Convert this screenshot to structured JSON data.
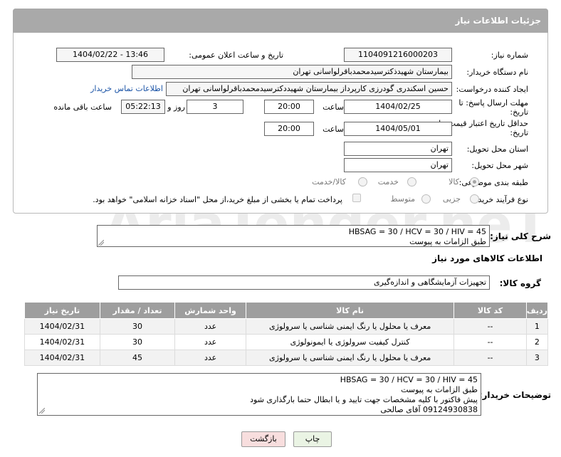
{
  "header": {
    "title": "جزئیات اطلاعات نیاز"
  },
  "fields": {
    "need_number_label": "شماره نیاز:",
    "need_number": "1104091216000203",
    "announce_label": "تاریخ و ساعت اعلان عمومی:",
    "announce_value": "1404/02/22 - 13:46",
    "buyer_org_label": "نام دستگاه خریدار:",
    "buyer_org": "بیمارستان شهیدذکترسیدمحمدباقرلواسانی تهران",
    "requester_label": "ایجاد کننده درخواست:",
    "requester": "حسین اسکندری گودرزی کارپرداز بیمارستان شهیددکترسیدمحمدباقرلواسانی تهران",
    "contact_link": "اطلاعات تماس خریدار",
    "deadline_label": "مهلت ارسال پاسخ: تا تاریخ:",
    "deadline_date": "1404/02/25",
    "time_label": "ساعت",
    "deadline_time": "20:00",
    "days_value": "3",
    "days_label": "روز و",
    "remaining_time": "05:22:13",
    "remaining_label": "ساعت باقی مانده",
    "price_validity_label": "حداقل تاریخ اعتبار قیمت: تا تاریخ:",
    "price_validity_date": "1404/05/01",
    "price_validity_time": "20:00",
    "province_label": "استان محل تحویل:",
    "province": "تهران",
    "city_label": "شهر محل تحویل:",
    "city": "تهران",
    "category_label": "طبقه بندی موضوعی:",
    "category_options": [
      "کالا",
      "خدمت",
      "کالا/خدمت"
    ],
    "category_selected": "کالا",
    "process_label": "نوع فرآیند خرید :",
    "process_options": [
      "جزیی",
      "متوسط"
    ],
    "payment_note": "پرداخت تمام یا بخشی از مبلغ خرید،از محل \"اسناد خزانه اسلامی\" خواهد بود."
  },
  "summary": {
    "label": "شرح کلی نیاز:",
    "text": "HBSAG = 30 / HCV = 30 / HIV = 45\nطبق الزامات به پیوست"
  },
  "goods": {
    "title": "اطلاعات کالاهای مورد نیاز",
    "group_label": "گروه کالا:",
    "group_value": "تجهیزات آزمایشگاهی و اندازه‌گیری"
  },
  "table": {
    "headers": [
      "ردیف",
      "کد کالا",
      "نام کالا",
      "واحد شمارش",
      "تعداد / مقدار",
      "تاریخ نیاز"
    ],
    "rows": [
      [
        "1",
        "--",
        "معرف یا محلول یا رنگ ایمنی شناسی یا سرولوژی",
        "عدد",
        "30",
        "1404/02/31"
      ],
      [
        "2",
        "--",
        "کنترل کیفیت سرولوژی یا ایمونولوژی",
        "عدد",
        "30",
        "1404/02/31"
      ],
      [
        "3",
        "--",
        "معرف یا محلول یا رنگ ایمنی شناسی یا سرولوژی",
        "عدد",
        "45",
        "1404/02/31"
      ]
    ]
  },
  "buyer_notes": {
    "label": "توضیحات خریدار:",
    "text": "HBSAG = 30 / HCV = 30 / HIV = 45\nطبق الزامات به پیوست\nپیش فاکتور با کلیه مشخصات جهت تایید و یا ابطال حتما بارگذاری شود\n09124930838 آقای صالحی"
  },
  "buttons": {
    "print": "چاپ",
    "back": "بازگشت"
  },
  "watermark": {
    "text": "AriaTender.neT"
  },
  "colors": {
    "header_bg": "#a9a9a9",
    "table_header_bg": "#9e9e9e",
    "link": "#1a53a6",
    "print_btn": "#eaf4e4",
    "back_btn": "#f8dede"
  }
}
